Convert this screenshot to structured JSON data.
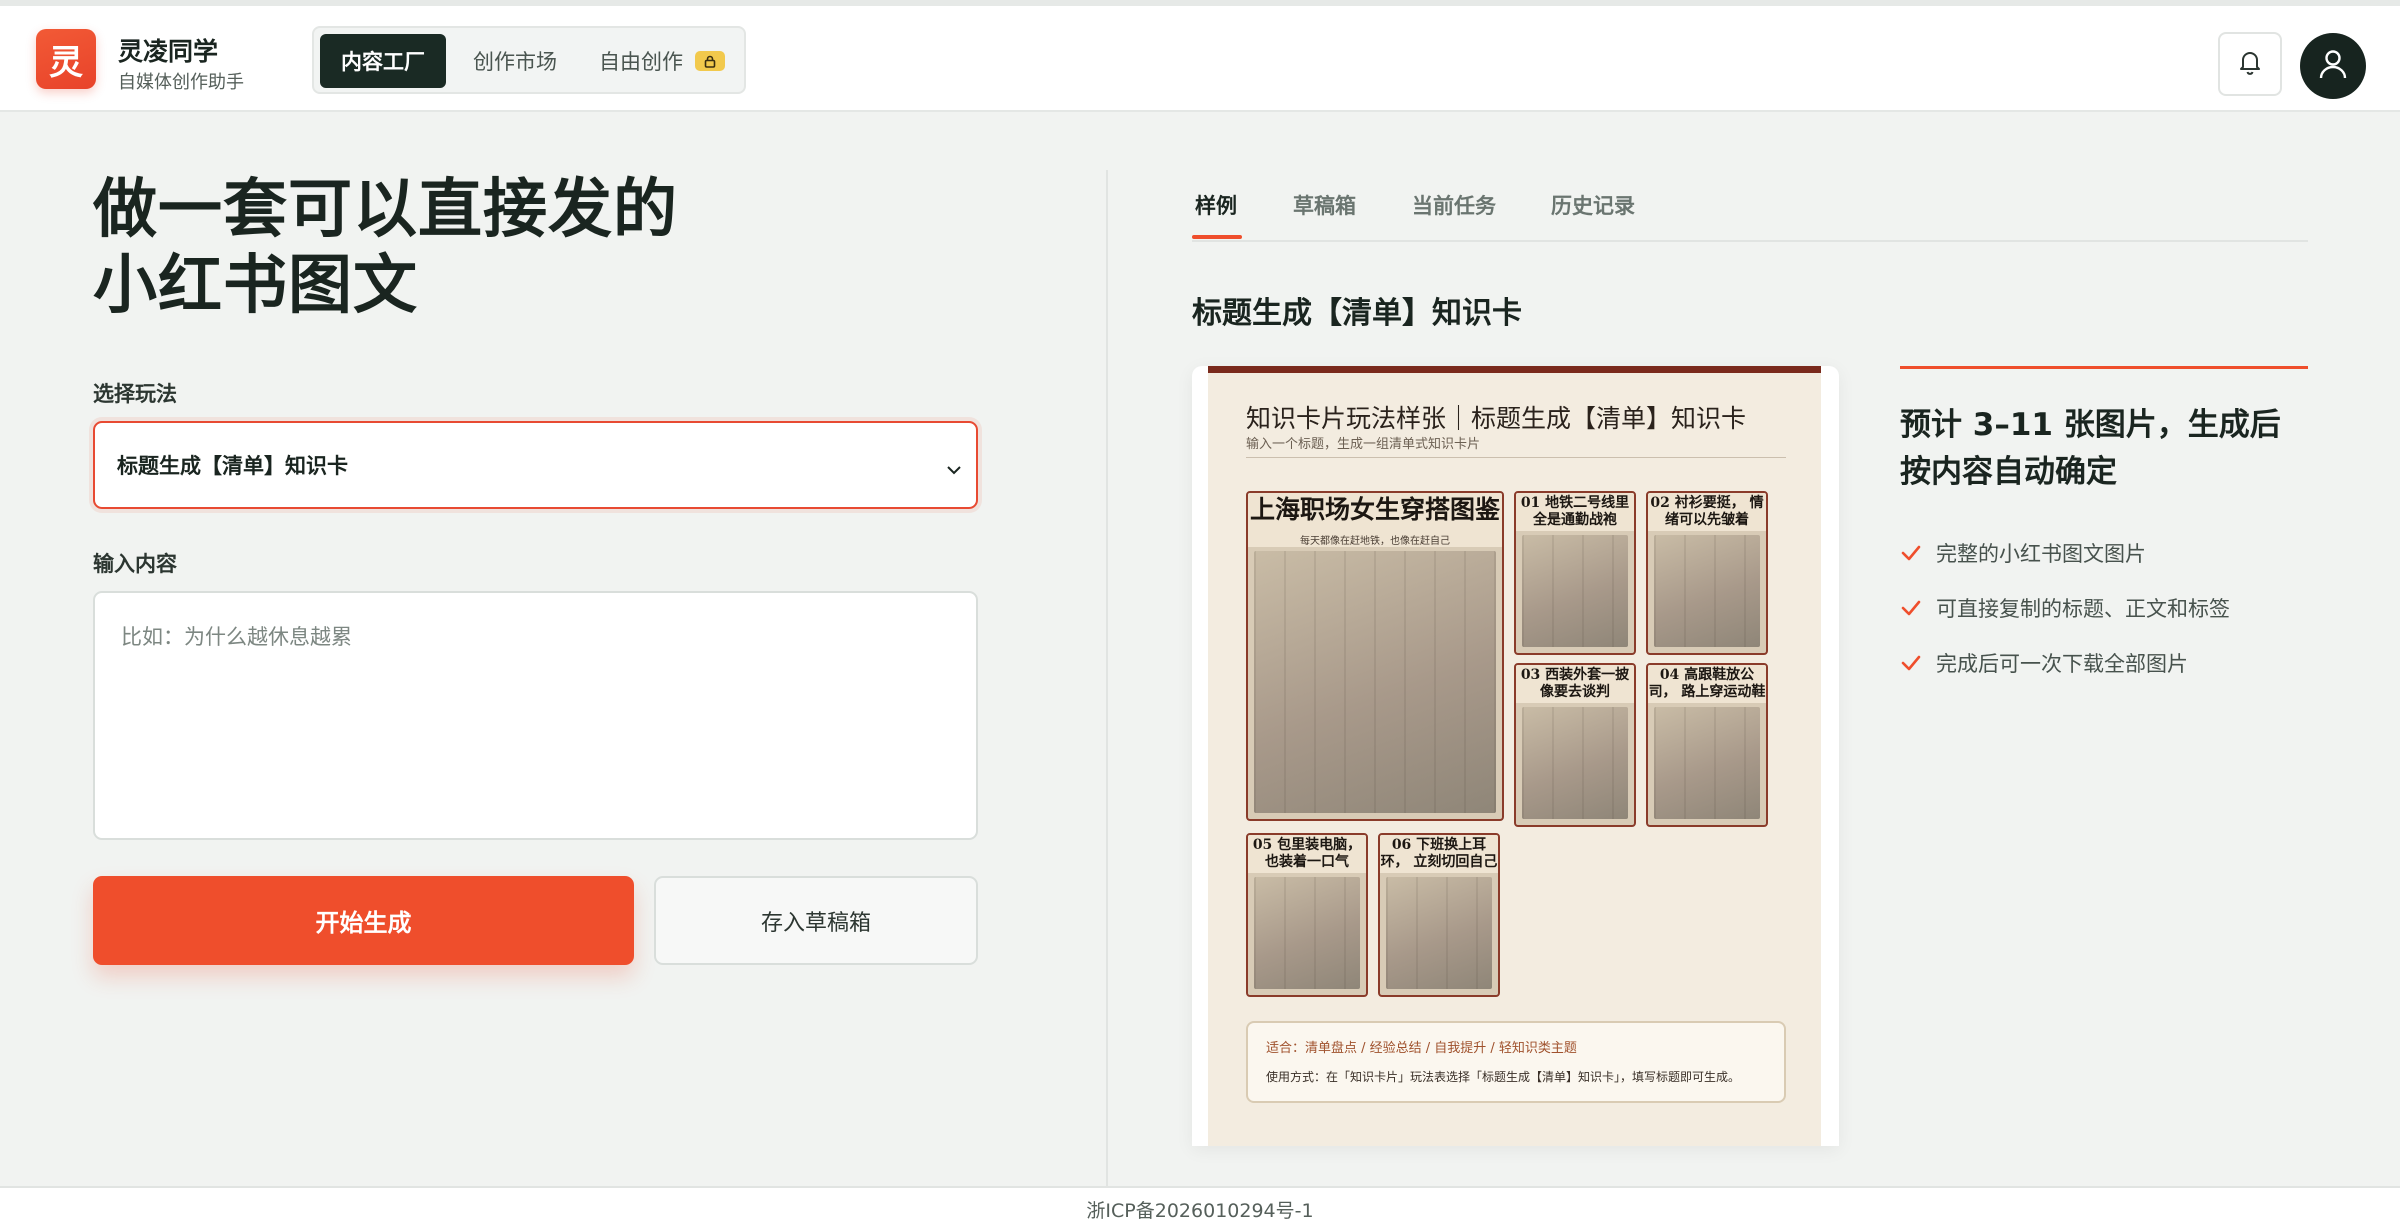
{
  "header": {
    "logo_char": "灵",
    "brand_name": "灵凌同学",
    "brand_sub": "自媒体创作助手",
    "nav": [
      {
        "label": "内容工厂",
        "active": true
      },
      {
        "label": "创作市场",
        "active": false
      },
      {
        "label": "自由创作",
        "active": false,
        "locked": true
      }
    ],
    "bell_icon": "bell-icon",
    "avatar_icon": "user-icon"
  },
  "left": {
    "hero_line1": "做一套可以直接发的",
    "hero_line2": "小红书图文",
    "mode_label": "选择玩法",
    "mode_value": "标题生成【清单】知识卡",
    "input_label": "输入内容",
    "input_placeholder": "比如：为什么越休息越累",
    "primary_button": "开始生成",
    "secondary_button": "存入草稿箱"
  },
  "right": {
    "tabs": [
      {
        "label": "样例",
        "active": true
      },
      {
        "label": "草稿箱",
        "active": false
      },
      {
        "label": "当前任务",
        "active": false
      },
      {
        "label": "历史记录",
        "active": false
      }
    ],
    "sample_title": "标题生成【清单】知识卡",
    "poster": {
      "title": "知识卡片玩法样张｜标题生成【清单】知识卡",
      "subtitle": "输入一个标题，生成一组清单式知识卡片",
      "main_card_title": "上海职场女生穿搭图鉴",
      "main_card_sub": "每天都像在赶地铁，也像在赶自己",
      "cards": [
        {
          "title": "01 地铁二号线里 全是通勤战袍"
        },
        {
          "title": "02 衬衫要挺， 情绪可以先皱着"
        },
        {
          "title": "03 西装外套一披 像要去谈判"
        },
        {
          "title": "04 高跟鞋放公司， 路上穿运动鞋"
        },
        {
          "title": "05 包里装电脑， 也装着一口气"
        },
        {
          "title": "06 下班换上耳环， 立刻切回自己"
        }
      ],
      "note_line1": "适合：清单盘点 / 经验总结 / 自我提升 / 轻知识类主题",
      "note_line2": "使用方式：在「知识卡片」玩法表选择「标题生成【清单】知识卡」，填写标题即可生成。"
    },
    "info_title": "预计 3–11 张图片，生成后按内容自动确定",
    "features": [
      "完整的小红书图文图片",
      "可直接复制的标题、正文和标签",
      "完成后可一次下载全部图片"
    ]
  },
  "footer": {
    "icp": "浙ICP备2026010294号-1"
  },
  "colors": {
    "accent": "#ef4e2c",
    "nav_active": "#1a2a24",
    "lock_badge": "#f2c94c"
  }
}
